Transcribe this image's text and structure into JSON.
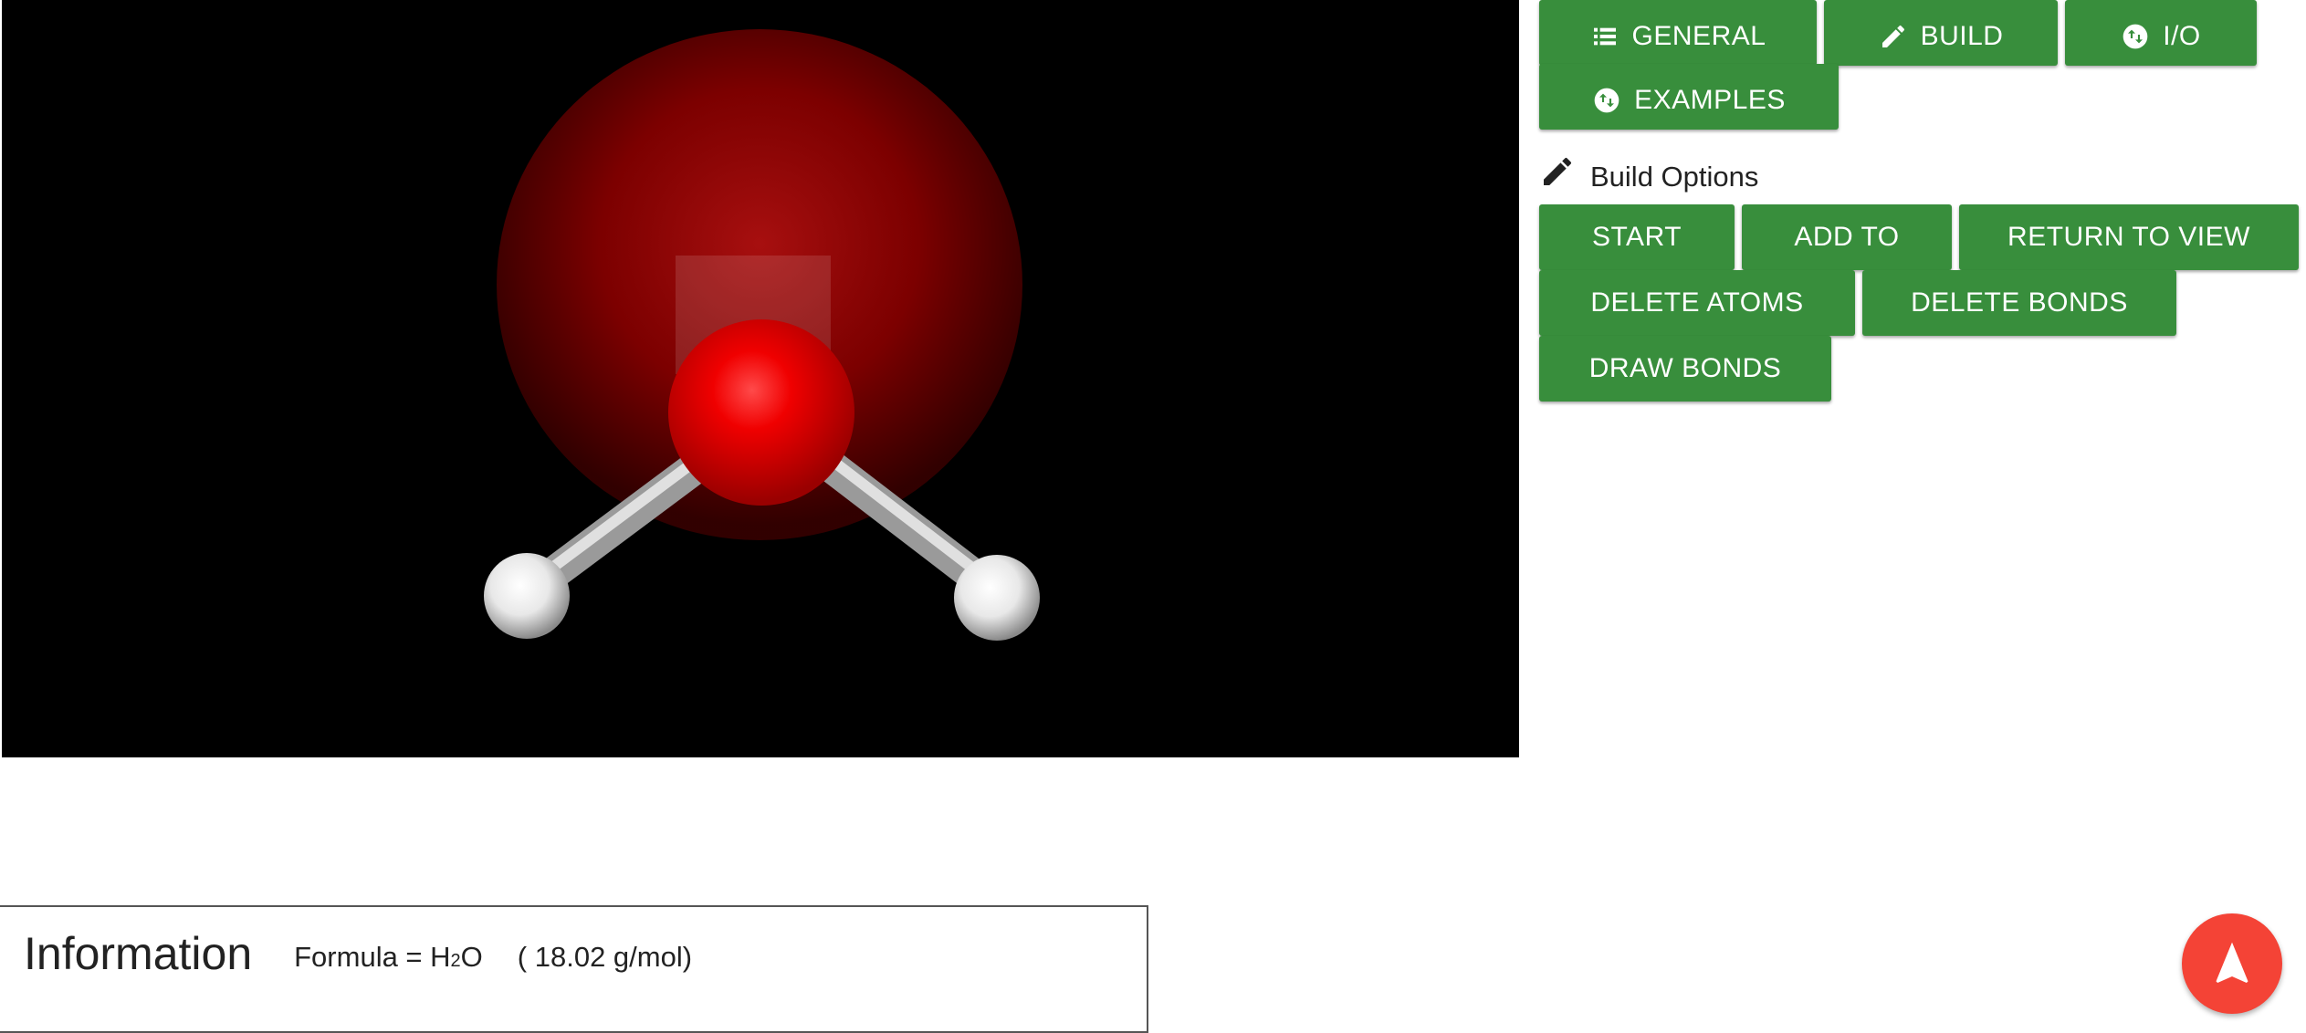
{
  "tabs": {
    "general_label": "GENERAL",
    "build_label": "BUILD",
    "io_label": "I/O",
    "examples_label": "EXAMPLES"
  },
  "build_options": {
    "title": "Build Options",
    "buttons": {
      "start": "START",
      "add_to": "ADD TO",
      "return_to_view": "RETURN TO VIEW",
      "delete_atoms": "DELETE ATOMS",
      "delete_bonds": "DELETE BONDS",
      "draw_bonds": "DRAW BONDS"
    }
  },
  "information": {
    "title": "Information",
    "formula_prefix": "Formula = H",
    "formula_subscript": "2",
    "formula_suffix": "O",
    "molar_mass": "( 18.02 g/mol)"
  },
  "icons": {
    "general": "list-icon",
    "build": "pencil-icon",
    "io": "swap-circle-icon",
    "examples": "swap-circle-icon",
    "build_options": "pencil-icon",
    "fab": "navigation-arrow-icon"
  },
  "colors": {
    "button_green": "#388e3c",
    "fab_red": "#f44336",
    "oxygen_red": "#e00000",
    "hydrogen_white": "#f4f4f4",
    "viewer_background": "#000000"
  }
}
